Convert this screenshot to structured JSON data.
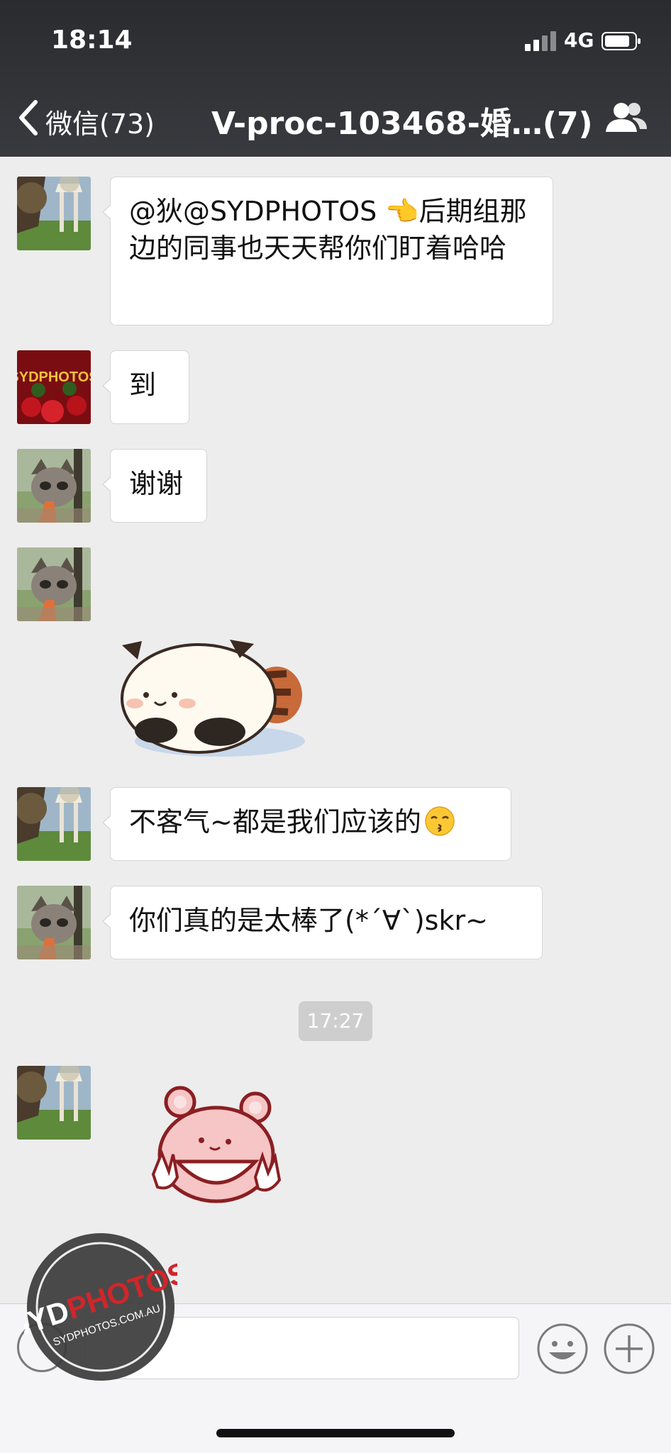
{
  "status_bar": {
    "time": "18:14",
    "network": "4G"
  },
  "header": {
    "back_label": "微信(73)",
    "title": "V-proc-103468-婚…(7)"
  },
  "messages": [
    {
      "text": "@狄@SYDPHOTOS 👈后期组那边的同事也天天帮你们盯着哈哈"
    },
    {
      "text": "到"
    },
    {
      "text": "谢谢"
    },
    {
      "sticker": "panda-sticker"
    },
    {
      "text": "不客气~都是我们应该的",
      "emoji": "kiss-emoji"
    },
    {
      "text": "你们真的是太棒了(*´∀`)skr~"
    }
  ],
  "timestamp": "17:27",
  "last_message": {
    "sticker": "bear-peace-sticker"
  },
  "watermark": {
    "brand": "SYDPHOTOS",
    "url": "SYDPHOTOS.COM.AU"
  },
  "colors": {
    "header_bg": "#393a3f",
    "chat_bg": "#ededed",
    "bubble_bg": "#ffffff",
    "timestamp_bg": "#cecece",
    "watermark_red": "#d0262b"
  }
}
